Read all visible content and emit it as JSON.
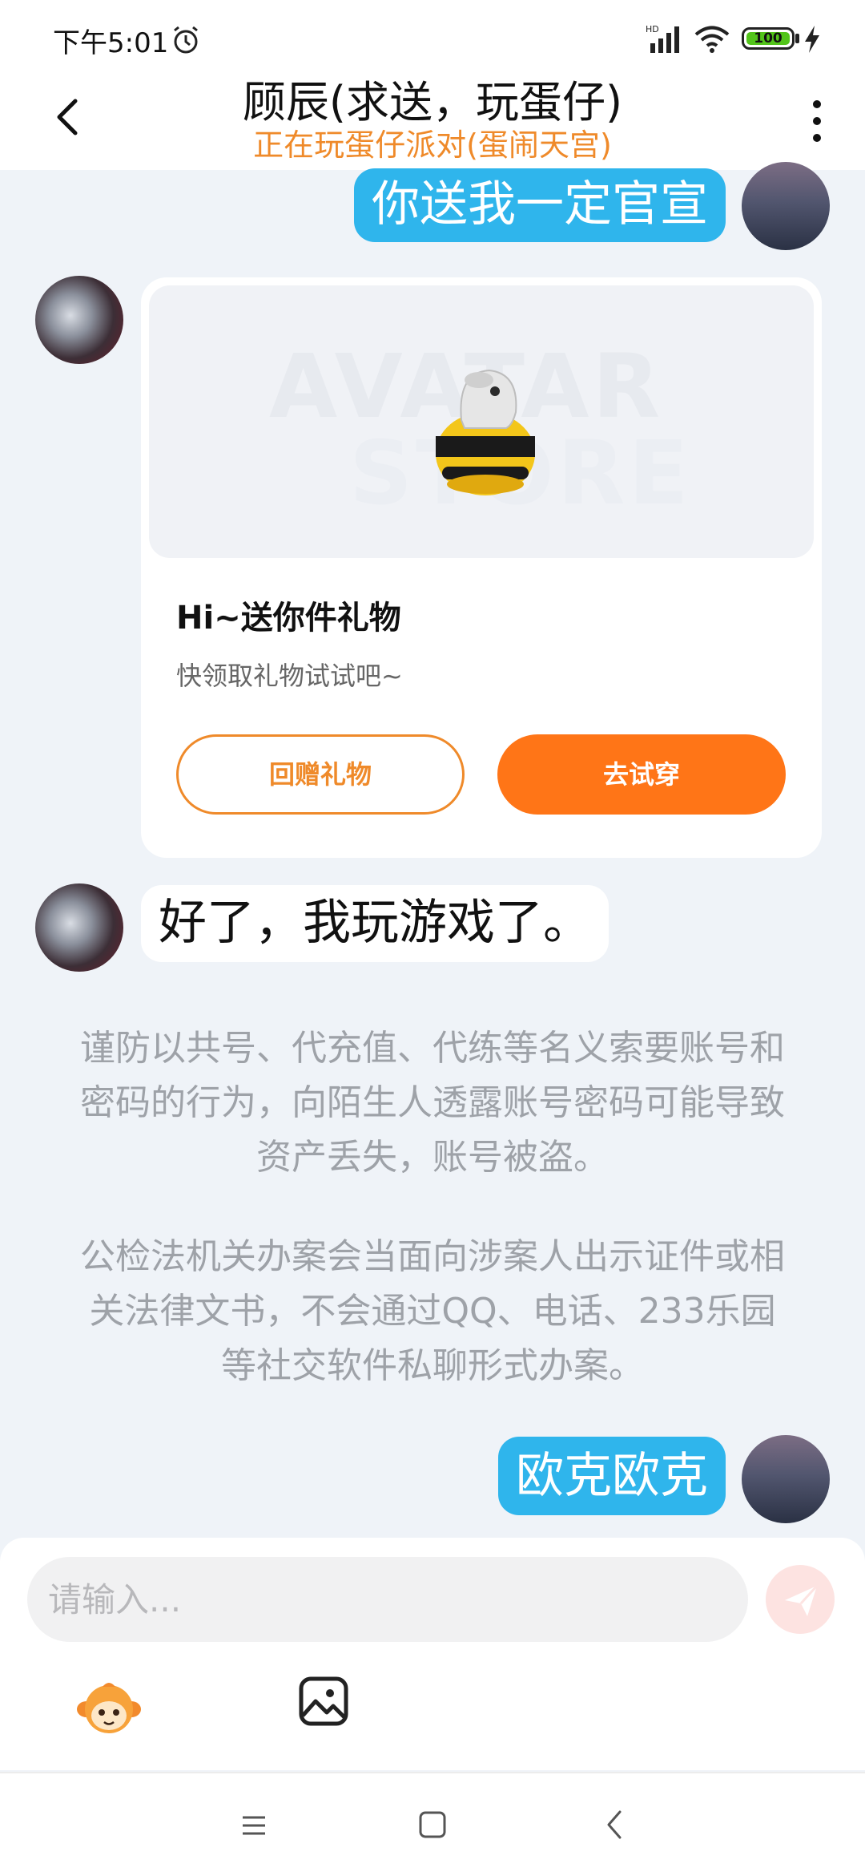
{
  "status_bar": {
    "time": "下午5:01",
    "battery_level": "100",
    "icons": [
      "alarm-icon",
      "signal-hd-icon",
      "wifi-icon",
      "battery-icon",
      "charging-icon"
    ]
  },
  "header": {
    "title": "顾辰(求送，玩蛋仔)",
    "subtitle": "正在玩蛋仔派对(蛋闹天宫)",
    "back_icon": "chevron-left-icon",
    "more_icon": "more-vertical-icon"
  },
  "messages": [
    {
      "sender": "me",
      "type": "text",
      "text": "你送我一定官宣"
    },
    {
      "sender": "other",
      "type": "gift_card",
      "watermark_line1": "AVATAR",
      "watermark_line2": "STORE",
      "title": "Hi~送你件礼物",
      "description": "快领取礼物试试吧~",
      "return_gift_label": "回赠礼物",
      "try_on_label": "去试穿"
    },
    {
      "sender": "other",
      "type": "text",
      "text": "好了，我玩游戏了。"
    },
    {
      "sender": "me",
      "type": "text",
      "text": "欧克欧克"
    }
  ],
  "notices": {
    "account_warning": "谨防以共号、代充值、代练等名义索要账号和密码的行为，向陌生人透露账号密码可能导致资产丢失，账号被盗。",
    "police_warning": "公检法机关办案会当面向涉案人出示证件或相关法律文书，不会通过QQ、电话、233乐园等社交软件私聊形式办案。"
  },
  "input": {
    "placeholder": "请输入...",
    "value": ""
  },
  "toolbar": {
    "icons": [
      "mascot-emoji-icon",
      "image-icon",
      "send-icon"
    ]
  },
  "colors": {
    "my_bubble": "#2fb5ec",
    "accent_orange": "#ff7517",
    "subtitle_orange": "#ef8a2a",
    "background": "#eff3f8"
  }
}
